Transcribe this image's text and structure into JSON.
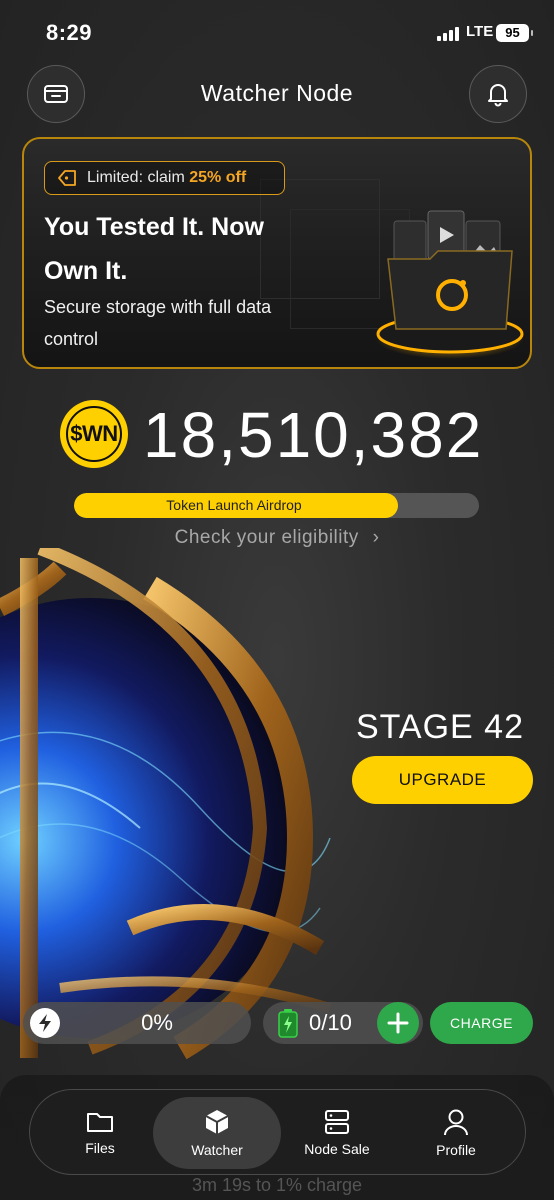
{
  "status_bar": {
    "time": "8:29",
    "network": "LTE",
    "battery": "95"
  },
  "header": {
    "title": "Watcher Node"
  },
  "promo": {
    "badge_prefix": "Limited: claim ",
    "badge_highlight": "25% off",
    "title": "You Tested It. Now Own It.",
    "subtitle": "Secure storage with full data control"
  },
  "balance": {
    "token_symbol": "$WN",
    "amount": "18,510,382"
  },
  "airdrop": {
    "label": "Token Launch Airdrop",
    "progress_fraction": 0.8,
    "eligibility_link": "Check your eligibility"
  },
  "stage": {
    "label": "STAGE 42",
    "upgrade_button": "UPGRADE"
  },
  "charge": {
    "energy_value": "0%",
    "battery_value": "0/10",
    "charge_button": "CHARGE"
  },
  "bottom": {
    "hint_text": "3m 19s to 1% charge"
  },
  "tabs": [
    {
      "label": "Files",
      "icon": "folder-icon",
      "active": false
    },
    {
      "label": "Watcher",
      "icon": "cube-icon",
      "active": true
    },
    {
      "label": "Node Sale",
      "icon": "server-icon",
      "active": false
    },
    {
      "label": "Profile",
      "icon": "user-icon",
      "active": false
    }
  ],
  "colors": {
    "accent_yellow": "#ffd000",
    "accent_green": "#2ea84a",
    "promo_border": "#b8860b",
    "badge_highlight": "#f5a623"
  }
}
